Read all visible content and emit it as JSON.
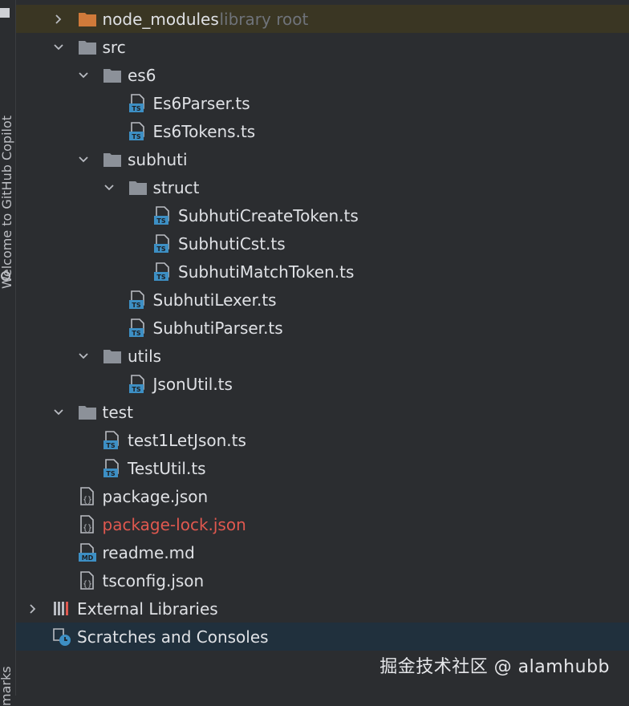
{
  "sidebar": {
    "copilot_label": "Welcome to GitHub Copilot",
    "bookmarks_label": "marks"
  },
  "tree": [
    {
      "label": "node_modules",
      "sub": "library root",
      "chevron": "right",
      "icon": "folder-orange-icon",
      "highlight": true
    },
    {
      "label": "src",
      "chevron": "down",
      "icon": "folder-icon"
    },
    {
      "label": "es6",
      "chevron": "down",
      "icon": "folder-icon"
    },
    {
      "label": "Es6Parser.ts",
      "icon": "typescript-file-icon"
    },
    {
      "label": "Es6Tokens.ts",
      "icon": "typescript-file-icon"
    },
    {
      "label": "subhuti",
      "chevron": "down",
      "icon": "folder-icon"
    },
    {
      "label": "struct",
      "chevron": "down",
      "icon": "folder-icon"
    },
    {
      "label": "SubhutiCreateToken.ts",
      "icon": "typescript-file-icon"
    },
    {
      "label": "SubhutiCst.ts",
      "icon": "typescript-file-icon"
    },
    {
      "label": "SubhutiMatchToken.ts",
      "icon": "typescript-file-icon"
    },
    {
      "label": "SubhutiLexer.ts",
      "icon": "typescript-file-icon"
    },
    {
      "label": "SubhutiParser.ts",
      "icon": "typescript-file-icon"
    },
    {
      "label": "utils",
      "chevron": "down",
      "icon": "folder-icon"
    },
    {
      "label": "JsonUtil.ts",
      "icon": "typescript-file-icon"
    },
    {
      "label": "test",
      "chevron": "down",
      "icon": "folder-icon"
    },
    {
      "label": "test1LetJson.ts",
      "icon": "typescript-file-icon"
    },
    {
      "label": "TestUtil.ts",
      "icon": "typescript-file-icon"
    },
    {
      "label": "package.json",
      "icon": "json-file-icon"
    },
    {
      "label": "package-lock.json",
      "icon": "json-file-icon",
      "color": "red"
    },
    {
      "label": "readme.md",
      "icon": "markdown-file-icon"
    },
    {
      "label": "tsconfig.json",
      "icon": "json-file-icon"
    },
    {
      "label": "External Libraries",
      "chevron": "right",
      "icon": "library-icon"
    },
    {
      "label": "Scratches and Consoles",
      "icon": "scratches-icon",
      "selected": true
    }
  ],
  "watermark": "掘金技术社区 @ alamhubb",
  "colors": {
    "background": "#2b2d30",
    "highlight_row": "#3a3623",
    "selected_row": "#20303d",
    "folder": "#8c9199",
    "folder_orange": "#d07a3a",
    "ts_badge": "#3d8fc4",
    "red_text": "#e0584f"
  }
}
